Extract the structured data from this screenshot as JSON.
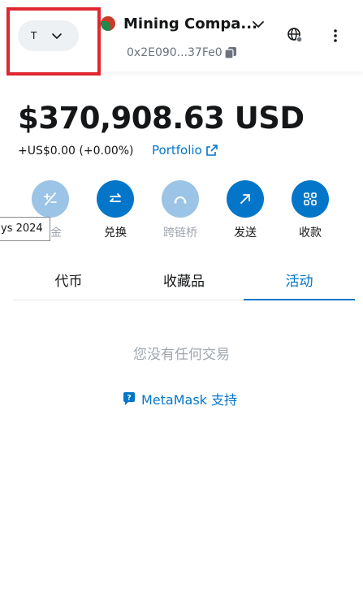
{
  "header": {
    "network_initial": "T",
    "account_name": "Mining Compa...",
    "account_address": "0x2E090...37Fe0",
    "icons": [
      "chevron-down-icon",
      "copy-icon",
      "globe-icon",
      "more-vertical-icon"
    ]
  },
  "balance": {
    "amount": "$370,908.63",
    "currency": "USD",
    "change": "+US$0.00 (+0.00%)",
    "portfolio_label": "Portfolio"
  },
  "actions": [
    {
      "label": "入金",
      "icon": "buy-sell-icon",
      "disabled": true
    },
    {
      "label": "兑换",
      "icon": "swap-icon",
      "disabled": false
    },
    {
      "label": "跨链桥",
      "icon": "bridge-icon",
      "disabled": true
    },
    {
      "label": "发送",
      "icon": "send-arrow-icon",
      "disabled": false
    },
    {
      "label": "收款",
      "icon": "qr-code-icon",
      "disabled": false
    }
  ],
  "tooltip": {
    "text": "ys 2024"
  },
  "tabs": [
    {
      "label": "代币",
      "active": false
    },
    {
      "label": "收藏品",
      "active": false
    },
    {
      "label": "活动",
      "active": true
    }
  ],
  "activity": {
    "empty_message": "您没有任何交易",
    "support_label": "MetaMask 支持"
  },
  "colors": {
    "primary": "#0376c9",
    "primary_disabled": "#9bc4e6",
    "highlight_box": "#e0262f",
    "muted_text": "#9fa6ae"
  }
}
